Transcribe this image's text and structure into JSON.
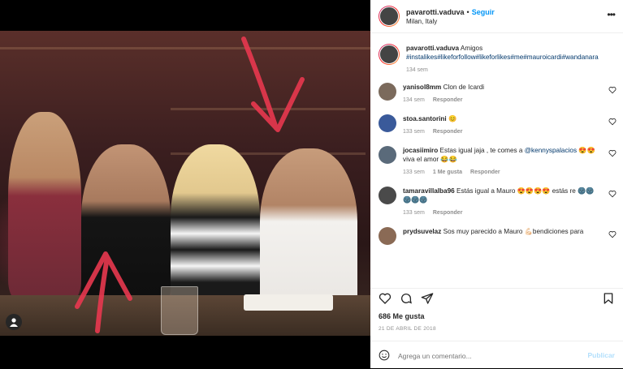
{
  "header": {
    "username": "pavarotti.vaduva",
    "separator": "•",
    "follow_label": "Seguir",
    "location": "Milan, Italy",
    "more_label": "•••"
  },
  "caption": {
    "username": "pavarotti.vaduva",
    "text": "Amigos",
    "hashtags": "#instalikes#likeforfollow#likeforlikes#me#mauroicardi#wandanara",
    "time": "134 sem"
  },
  "comments": [
    {
      "username": "yanisol8mm",
      "text": "Clon de Icardi",
      "time": "134 sem",
      "likes": "",
      "reply": "Responder"
    },
    {
      "username": "stoa.santorini",
      "text": "😊",
      "time": "133 sem",
      "likes": "",
      "reply": "Responder"
    },
    {
      "username": "jocasiimiro",
      "text": "Estas igual jaja , te comes a",
      "mention": "@kennyspalacios",
      "text2": "😍😍 viva el amor 😂😂",
      "time": "133 sem",
      "likes": "1 Me gusta",
      "reply": "Responder"
    },
    {
      "username": "tamaravillalba96",
      "text": "Estás igual a Mauro 😍😍😍😍 estás re 🌚🌚🌚🌚🌚",
      "time": "133 sem",
      "likes": "",
      "reply": "Responder"
    },
    {
      "username": "prydsuvelaz",
      "text": "Sos muy parecido a Mauro 💪🏻bendiciones para",
      "time": "",
      "likes": "",
      "reply": ""
    }
  ],
  "likes": "686 Me gusta",
  "date": "21 DE ABRIL DE 2018",
  "comment_box": {
    "placeholder": "Agrega un comentario...",
    "publish_label": "Publicar"
  },
  "colors": {
    "accent": "#0095f6",
    "publish_disabled": "#b2dffc",
    "text": "#262626",
    "muted": "#8e8e8e",
    "annotation_arrow": "#e8384f"
  }
}
